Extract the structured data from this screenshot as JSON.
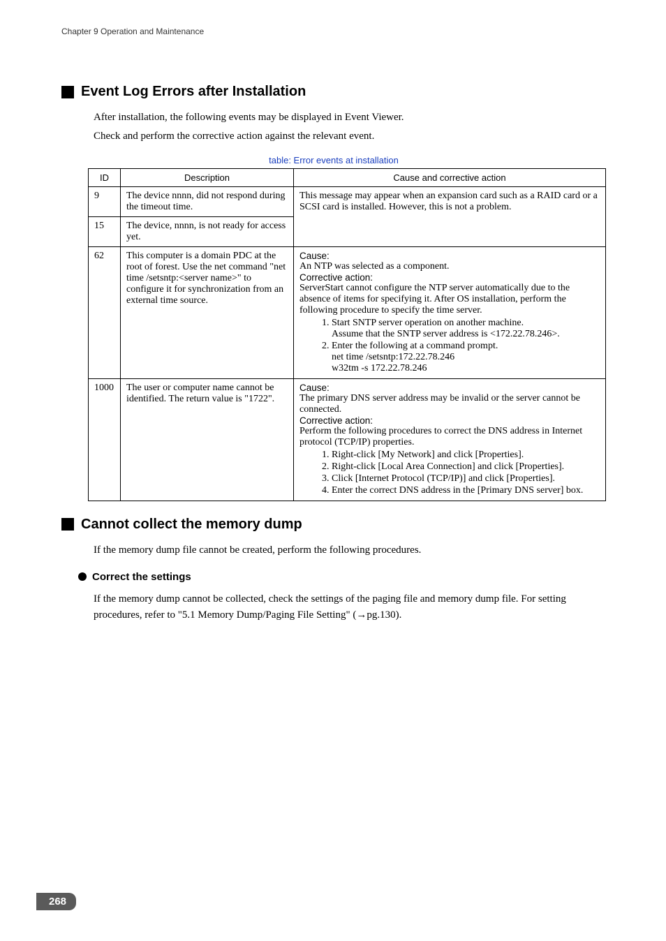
{
  "header": {
    "chapter": "Chapter 9  Operation and Maintenance"
  },
  "sec1": {
    "title": "Event Log Errors after Installation",
    "p1": "After installation, the following events may be displayed in Event Viewer.",
    "p2": " Check and perform the corrective action against the relevant event.",
    "tableCaption": "table: Error events at installation",
    "th": {
      "id": "ID",
      "desc": "Description",
      "cause": "Cause and corrective action"
    },
    "rows": {
      "r1": {
        "id": "9",
        "desc": "The device nnnn, did not respond during the timeout time.",
        "cause": "This message may appear when an expansion card such as a RAID card or a SCSI card is installed. However, this is not a problem."
      },
      "r2": {
        "id": "15",
        "desc": "The device, nnnn, is not ready for access yet."
      },
      "r3": {
        "id": "62",
        "desc": "This computer is a domain PDC at the root of forest. Use the net command \"net time /setsntp:<server name>\" to configure it for synchronization from an external time source.",
        "cause_label": "Cause:",
        "cause_text": "An NTP was selected as a component.",
        "corr_label": "Corrective action:",
        "corr_text1": "ServerStart cannot configure the NTP server automatically due to the absence of items for specifying it. After OS installation, perform the following procedure to specify the time server.",
        "s1": "Start SNTP server operation on another machine.",
        "s1a": "Assume that the SNTP server address is <172.22.78.246>.",
        "s2": "Enter the following at a command prompt.",
        "s2a": "net time /setsntp:172.22.78.246",
        "s2b": "w32tm -s 172.22.78.246"
      },
      "r4": {
        "id": "1000",
        "desc": "The user or computer name cannot be identified. The return value is \"1722\".",
        "cause_label": "Cause:",
        "cause_text": "The primary DNS server address may be invalid or the server cannot be connected.",
        "corr_label": "Corrective action:",
        "corr_text1": "Perform the following procedures to correct the DNS address in Internet protocol (TCP/IP) properties.",
        "s1": "Right-click [My Network] and click [Properties].",
        "s2": "Right-click [Local Area Connection] and click [Properties].",
        "s3": "Click [Internet Protocol (TCP/IP)] and click [Properties].",
        "s4": "Enter the correct DNS address in the [Primary DNS server] box."
      }
    }
  },
  "sec2": {
    "title": "Cannot collect the memory dump",
    "p1": "If the memory dump file cannot be created, perform the following procedures.",
    "sub1": {
      "title": "Correct the settings",
      "p1": "If the memory dump cannot be collected, check the settings of the paging file and memory dump file. For setting procedures, refer to \"5.1 Memory Dump/Paging File Setting\" (→pg.130)."
    }
  },
  "page": "268"
}
